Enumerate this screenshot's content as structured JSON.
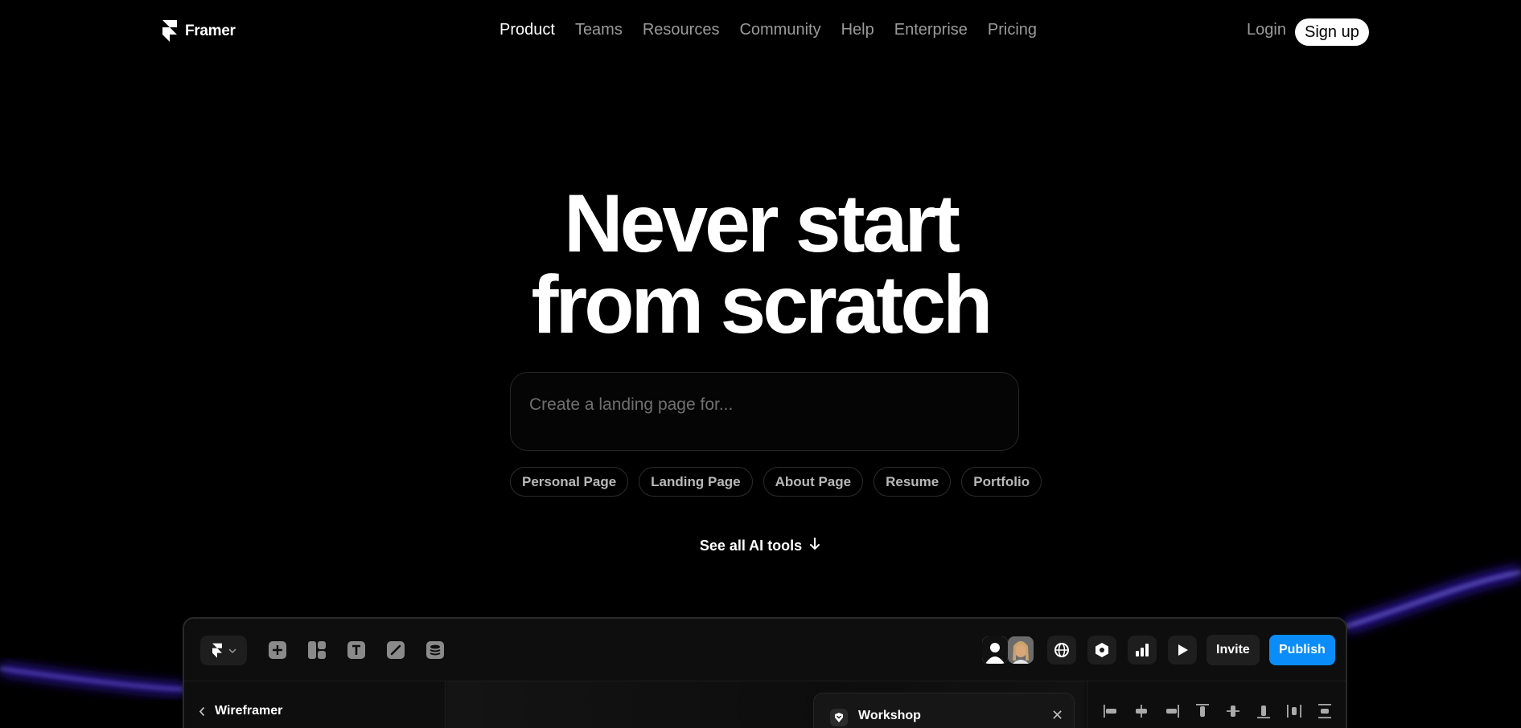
{
  "brand": {
    "name": "Framer"
  },
  "nav": {
    "links": [
      "Product",
      "Teams",
      "Resources",
      "Community",
      "Help",
      "Enterprise",
      "Pricing"
    ],
    "active": "Product",
    "login": "Login",
    "signup": "Sign up"
  },
  "hero": {
    "title_line1": "Never start",
    "title_line2": "from scratch",
    "prompt_placeholder": "Create a landing page for...",
    "chips": [
      "Personal Page",
      "Landing Page",
      "About Page",
      "Resume",
      "Portfolio"
    ],
    "see_all": "See all AI tools",
    "see_all_icon": "arrow-down-icon"
  },
  "editor": {
    "invite_label": "Invite",
    "publish_label": "Publish",
    "project_name": "Wireframer",
    "workshop_title": "Workshop",
    "toolbar_icons": [
      "framer-menu-icon",
      "insert-icon",
      "layout-icon",
      "text-icon",
      "vector-icon",
      "cms-icon"
    ],
    "right_icons": [
      "globe-icon",
      "settings-icon",
      "analytics-icon",
      "play-icon"
    ],
    "accent_color": "#0a8df8"
  },
  "colors": {
    "glow": "#5b3bff",
    "background": "#000000"
  }
}
